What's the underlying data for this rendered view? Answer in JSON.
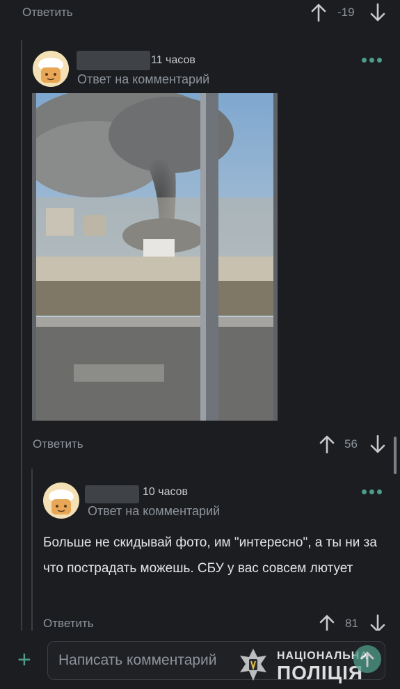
{
  "top_comment_footer": {
    "reply_label": "Ответить",
    "score": "-19"
  },
  "comment1": {
    "time": "11 часов",
    "subtitle": "Ответ на комментарий",
    "footer": {
      "reply_label": "Ответить",
      "score": "56"
    }
  },
  "comment2": {
    "time": "10 часов",
    "subtitle": "Ответ на комментарий",
    "text": "Больше не скидывай фото, им \"интересно\", а ты ни за что пострадать можешь. СБУ у вас совсем лютует",
    "footer": {
      "reply_label": "Ответить",
      "score": "81"
    }
  },
  "composer": {
    "add_symbol": "+",
    "placeholder": "Написать комментарий"
  },
  "watermark": {
    "line1": "НАЦІОНАЛЬНА",
    "line2": "ПОЛІЦІЯ"
  },
  "colors": {
    "background": "#1b1d21",
    "accent": "#4e9c89",
    "muted_text": "#8e949b"
  },
  "icons": [
    "arrow-up-icon",
    "arrow-down-icon",
    "more-dots-icon",
    "plus-icon",
    "police-emblem-icon"
  ]
}
